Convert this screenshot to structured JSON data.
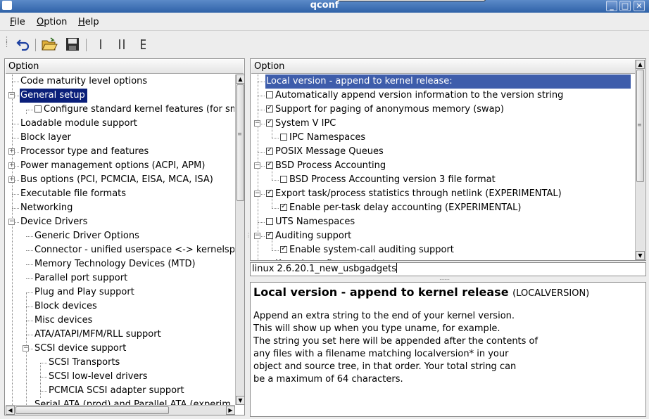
{
  "window": {
    "title": "qconf"
  },
  "menu": {
    "file": "File",
    "option": "Option",
    "help": "Help"
  },
  "left": {
    "header": "Option",
    "items": [
      "Code maturity level options",
      "General setup",
      "Configure standard kernel features (for sm",
      "Loadable module support",
      "Block layer",
      "Processor type and features",
      "Power management options (ACPI, APM)",
      "Bus options (PCI, PCMCIA, EISA, MCA, ISA)",
      "Executable file formats",
      "Networking",
      "Device Drivers",
      "Generic Driver Options",
      "Connector - unified userspace <-> kernelsp",
      "Memory Technology Devices (MTD)",
      "Parallel port support",
      "Plug and Play support",
      "Block devices",
      "Misc devices",
      "ATA/ATAPI/MFM/RLL support",
      "SCSI device support",
      "SCSI Transports",
      "SCSI low-level drivers",
      "PCMCIA SCSI adapter support",
      "Serial ATA (prod) and Parallel ATA (experim"
    ]
  },
  "right": {
    "header": "Option",
    "items": [
      "Local version - append to kernel release:",
      "Automatically append version information to the version string",
      "Support for paging of anonymous memory (swap)",
      "System V IPC",
      "IPC Namespaces",
      "POSIX Message Queues",
      "BSD Process Accounting",
      "BSD Process Accounting version 3 file format",
      "Export task/process statistics through netlink (EXPERIMENTAL)",
      "Enable per-task delay accounting (EXPERIMENTAL)",
      "UTS Namespaces",
      "Auditing support",
      "Enable system-call auditing support",
      "Kernel .config support"
    ],
    "checked": [
      false,
      false,
      true,
      true,
      false,
      true,
      true,
      false,
      true,
      true,
      false,
      true,
      true,
      false
    ]
  },
  "edit": {
    "value": "linux 2.6.20.1_new_usbgadgets"
  },
  "help": {
    "title": "Local version - append to kernel release",
    "symbol": "(LOCALVERSION)",
    "lines": [
      "Append an extra string to the end of your kernel version.",
      "This will show up when you type uname, for example.",
      "The string you set here will be appended after the contents of",
      "any files with a filename matching localversion* in your",
      "object and source tree, in that order. Your total string can",
      "be a maximum of 64 characters."
    ]
  },
  "colors": {
    "selection": "#0a1f7a",
    "selection_inactive": "#3e5dab",
    "titlebar": "#3d6cb0"
  },
  "icons": {
    "window": "window-menu-icon",
    "back": "back-arrow-icon",
    "open": "open-folder-icon",
    "save": "save-disk-icon",
    "single": "single-view-icon",
    "split": "split-view-icon",
    "full": "full-view-icon"
  }
}
